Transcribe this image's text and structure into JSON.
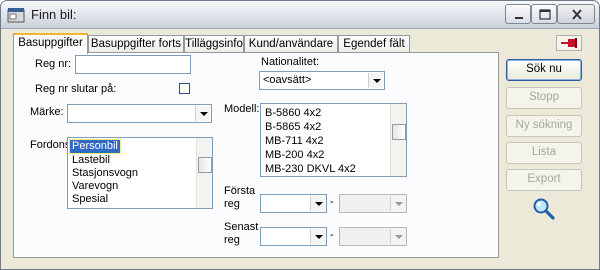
{
  "window": {
    "title": "Finn bil:"
  },
  "tabs": [
    {
      "label": "Basuppgifter",
      "active": true
    },
    {
      "label": "Basuppgifter forts",
      "active": false
    },
    {
      "label": "Tilläggsinfo",
      "active": false
    },
    {
      "label": "Kund/användare",
      "active": false
    },
    {
      "label": "Egendef fält",
      "active": false
    }
  ],
  "form": {
    "reg_nr_label": "Reg nr:",
    "reg_nr_value": "",
    "reg_nr_ends_label": "Reg nr slutar på:",
    "reg_nr_ends_checked": false,
    "marke_label": "Märke:",
    "marke_value": "",
    "fordon_label": "Fordons",
    "fordon_items": [
      "Personbil",
      "Lastebil",
      "Stasjonsvogn",
      "Varevogn",
      "Spesial"
    ],
    "fordon_selected": "Personbil",
    "nationalitet_label": "Nationalitet:",
    "nationalitet_value": "<oavsätt>",
    "modell_label": "Modell:",
    "modell_items": [
      "B-5860 4x2",
      "B-5865 4x2",
      "MB-711 4x2",
      "MB-200 4x2",
      "MB-230 DKVL 4x2"
    ],
    "forsta_reg_label_1": "Första",
    "forsta_reg_label_2": "reg",
    "senast_reg_label_1": "Senast",
    "senast_reg_label_2": "reg",
    "range_dash": "-"
  },
  "buttons": {
    "sok_nu": "Sök nu",
    "stopp": "Stopp",
    "ny_sokning": "Ny sökning",
    "lista": "Lista",
    "export": "Export"
  },
  "colors": {
    "selection": "#316ac5",
    "tab_highlight": "#f5b330",
    "window_bg": "#ece9d8"
  },
  "icons": [
    "app-icon",
    "minimize-icon",
    "maximize-icon",
    "close-icon",
    "pin-icon",
    "magnifier-icon"
  ]
}
